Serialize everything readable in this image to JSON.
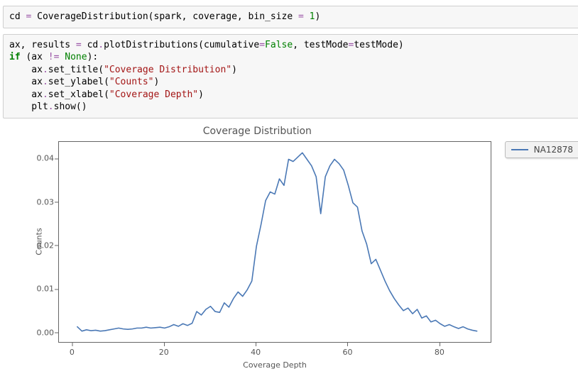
{
  "code_cell_1_tokens": [
    {
      "t": "cd ",
      "c": "tok-name"
    },
    {
      "t": "=",
      "c": "tok-op"
    },
    {
      "t": " CoverageDistribution(spark, coverage, bin_size ",
      "c": "tok-name"
    },
    {
      "t": "=",
      "c": "tok-op"
    },
    {
      "t": " ",
      "c": "tok-name"
    },
    {
      "t": "1",
      "c": "tok-num"
    },
    {
      "t": ")",
      "c": "tok-name"
    }
  ],
  "code_cell_2_tokens": [
    {
      "t": "ax, results ",
      "c": "tok-name"
    },
    {
      "t": "=",
      "c": "tok-op"
    },
    {
      "t": " cd",
      "c": "tok-name"
    },
    {
      "t": ".",
      "c": "tok-op"
    },
    {
      "t": "plotDistributions(cumulative",
      "c": "tok-name"
    },
    {
      "t": "=",
      "c": "tok-op"
    },
    {
      "t": "False",
      "c": "tok-const"
    },
    {
      "t": ", testMode",
      "c": "tok-name"
    },
    {
      "t": "=",
      "c": "tok-op"
    },
    {
      "t": "testMode)",
      "c": "tok-name"
    },
    {
      "t": "\n",
      "c": ""
    },
    {
      "t": "if",
      "c": "tok-kw"
    },
    {
      "t": " (ax ",
      "c": "tok-name"
    },
    {
      "t": "!=",
      "c": "tok-op"
    },
    {
      "t": " ",
      "c": "tok-name"
    },
    {
      "t": "None",
      "c": "tok-const"
    },
    {
      "t": "):",
      "c": "tok-name"
    },
    {
      "t": "\n",
      "c": ""
    },
    {
      "t": "    ax",
      "c": "tok-name"
    },
    {
      "t": ".",
      "c": "tok-op"
    },
    {
      "t": "set_title(",
      "c": "tok-name"
    },
    {
      "t": "\"Coverage Distribution\"",
      "c": "tok-str"
    },
    {
      "t": ")",
      "c": "tok-name"
    },
    {
      "t": "\n",
      "c": ""
    },
    {
      "t": "    ax",
      "c": "tok-name"
    },
    {
      "t": ".",
      "c": "tok-op"
    },
    {
      "t": "set_ylabel(",
      "c": "tok-name"
    },
    {
      "t": "\"Counts\"",
      "c": "tok-str"
    },
    {
      "t": ")",
      "c": "tok-name"
    },
    {
      "t": "\n",
      "c": ""
    },
    {
      "t": "    ax",
      "c": "tok-name"
    },
    {
      "t": ".",
      "c": "tok-op"
    },
    {
      "t": "set_xlabel(",
      "c": "tok-name"
    },
    {
      "t": "\"Coverage Depth\"",
      "c": "tok-str"
    },
    {
      "t": ")",
      "c": "tok-name"
    },
    {
      "t": "\n",
      "c": ""
    },
    {
      "t": "    plt",
      "c": "tok-name"
    },
    {
      "t": ".",
      "c": "tok-op"
    },
    {
      "t": "show()",
      "c": "tok-name"
    }
  ],
  "chart_data": {
    "type": "line",
    "title": "Coverage Distribution",
    "xlabel": "Coverage Depth",
    "ylabel": "Counts",
    "xlim": [
      -3,
      91
    ],
    "ylim": [
      -0.002,
      0.044
    ],
    "xticks": [
      0,
      20,
      40,
      60,
      80
    ],
    "yticks": [
      0.0,
      0.01,
      0.02,
      0.03,
      0.04
    ],
    "series": [
      {
        "name": "NA12878",
        "x": [
          1,
          2,
          3,
          4,
          5,
          6,
          7,
          8,
          9,
          10,
          11,
          12,
          13,
          14,
          15,
          16,
          17,
          18,
          19,
          20,
          21,
          22,
          23,
          24,
          25,
          26,
          27,
          28,
          29,
          30,
          31,
          32,
          33,
          34,
          35,
          36,
          37,
          38,
          39,
          40,
          41,
          42,
          43,
          44,
          45,
          46,
          47,
          48,
          49,
          50,
          51,
          52,
          53,
          54,
          55,
          56,
          57,
          58,
          59,
          60,
          61,
          62,
          63,
          64,
          65,
          66,
          67,
          68,
          69,
          70,
          71,
          72,
          73,
          74,
          75,
          76,
          77,
          78,
          79,
          80,
          81,
          82,
          83,
          84,
          85,
          86,
          87,
          88
        ],
        "y": [
          0.0015,
          0.0005,
          0.0008,
          0.0006,
          0.0007,
          0.0005,
          0.0006,
          0.0008,
          0.001,
          0.0012,
          0.001,
          0.0009,
          0.001,
          0.0012,
          0.0012,
          0.0014,
          0.0012,
          0.0013,
          0.0014,
          0.0012,
          0.0015,
          0.002,
          0.0016,
          0.0022,
          0.0018,
          0.0023,
          0.005,
          0.0042,
          0.0055,
          0.0062,
          0.005,
          0.0048,
          0.007,
          0.006,
          0.008,
          0.0095,
          0.0085,
          0.01,
          0.012,
          0.02,
          0.025,
          0.0305,
          0.0325,
          0.032,
          0.0355,
          0.034,
          0.04,
          0.0395,
          0.0405,
          0.0415,
          0.04,
          0.0385,
          0.036,
          0.0275,
          0.036,
          0.0385,
          0.04,
          0.039,
          0.0375,
          0.034,
          0.03,
          0.029,
          0.0235,
          0.0205,
          0.016,
          0.017,
          0.0145,
          0.012,
          0.0098,
          0.008,
          0.0065,
          0.0052,
          0.0058,
          0.0045,
          0.0055,
          0.0035,
          0.004,
          0.0026,
          0.003,
          0.0022,
          0.0016,
          0.002,
          0.0015,
          0.0011,
          0.0015,
          0.001,
          0.0007,
          0.0005
        ]
      }
    ]
  },
  "legend_label": "NA12878"
}
